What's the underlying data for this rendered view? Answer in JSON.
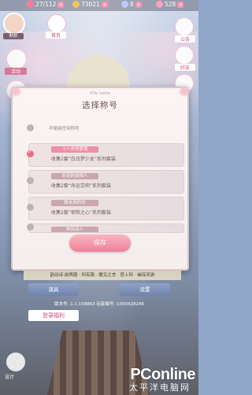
{
  "topbar": {
    "stamina": "27/112",
    "coins": "73021",
    "diamonds": "8",
    "gems": "528"
  },
  "left": {
    "player_name": "默默",
    "home_label": "首页",
    "event_label": "活动",
    "blank_label": "",
    "setting_label": "设计"
  },
  "right": {
    "notice_label": "公告",
    "friends_label": "好友",
    "mail_label": "邮件"
  },
  "dialog": {
    "subtitle": "title name",
    "title": "选择称号",
    "options": [
      {
        "tag": "",
        "desc": "不使用任何称号",
        "selected": false
      },
      {
        "tag": "十八岁的梦境",
        "desc": "收集2套“白日梦少女”系列套装",
        "selected": true
      },
      {
        "tag": "命运的抉择人",
        "desc": "收集2套“命运交响”系列套装",
        "selected": false
      },
      {
        "tag": "致未来的你",
        "desc": "收集2套“钢铁之心”系列套装",
        "selected": false
      },
      {
        "tag": "林间诗人",
        "desc": "",
        "selected": false
      }
    ],
    "save_label": "保存"
  },
  "stage_text": "韵动诗·前两届 · 科有路 · 暖见之言 · 密上科 · 幽深灵游",
  "buttons": {
    "tools": "道具",
    "settings": "设置"
  },
  "version": "版本号: 1.1.158863   玩家编号: 1000428249",
  "login_tag": "登录福利",
  "watermark": {
    "main": "PConline",
    "sub": "太平洋电脑网"
  }
}
